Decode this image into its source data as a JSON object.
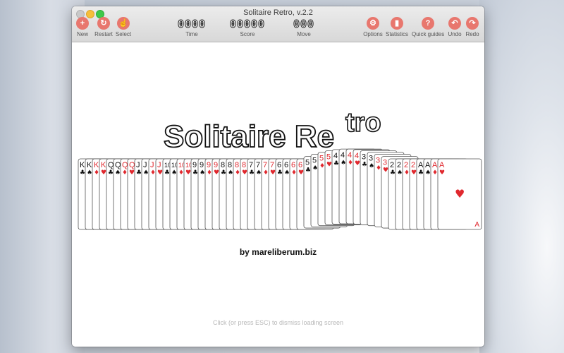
{
  "window": {
    "title": "Solitaire Retro, v.2.2"
  },
  "toolbar": {
    "left": [
      {
        "label": "New",
        "icon": "plus-icon",
        "glyph": "+"
      },
      {
        "label": "Restart",
        "icon": "restart-icon",
        "glyph": "↻"
      },
      {
        "label": "Select",
        "icon": "hand-pointer-icon",
        "glyph": "☝"
      }
    ],
    "right": [
      {
        "label": "Options",
        "icon": "gear-icon",
        "glyph": "⚙"
      },
      {
        "label": "Statistics",
        "icon": "bar-chart-icon",
        "glyph": "▮"
      },
      {
        "label": "Quick guides",
        "icon": "question-icon",
        "glyph": "?"
      },
      {
        "label": "Undo",
        "icon": "undo-arrow-icon",
        "glyph": "↶"
      },
      {
        "label": "Redo",
        "icon": "redo-arrow-icon",
        "glyph": "↷"
      }
    ]
  },
  "counters": {
    "time": {
      "value": "0000",
      "label": "Time"
    },
    "score": {
      "value": "00000",
      "label": "Score"
    },
    "move": {
      "value": "000",
      "label": "Move"
    }
  },
  "splash": {
    "logo_main": "Solitaire Re",
    "logo_super": "tro",
    "byline": "by mareliberum.biz",
    "hint": "Click (or press ESC) to dismiss loading screen"
  },
  "cards": [
    {
      "rank": "K",
      "suit": "♣"
    },
    {
      "rank": "K",
      "suit": "♠"
    },
    {
      "rank": "K",
      "suit": "♦"
    },
    {
      "rank": "K",
      "suit": "♥"
    },
    {
      "rank": "Q",
      "suit": "♣"
    },
    {
      "rank": "Q",
      "suit": "♠"
    },
    {
      "rank": "Q",
      "suit": "♦"
    },
    {
      "rank": "Q",
      "suit": "♥"
    },
    {
      "rank": "J",
      "suit": "♣"
    },
    {
      "rank": "J",
      "suit": "♠"
    },
    {
      "rank": "J",
      "suit": "♦"
    },
    {
      "rank": "J",
      "suit": "♥"
    },
    {
      "rank": "10",
      "suit": "♣"
    },
    {
      "rank": "10",
      "suit": "♠"
    },
    {
      "rank": "10",
      "suit": "♦"
    },
    {
      "rank": "10",
      "suit": "♥"
    },
    {
      "rank": "9",
      "suit": "♣"
    },
    {
      "rank": "9",
      "suit": "♠"
    },
    {
      "rank": "9",
      "suit": "♦"
    },
    {
      "rank": "9",
      "suit": "♥"
    },
    {
      "rank": "8",
      "suit": "♣"
    },
    {
      "rank": "8",
      "suit": "♠"
    },
    {
      "rank": "8",
      "suit": "♦"
    },
    {
      "rank": "8",
      "suit": "♥"
    },
    {
      "rank": "7",
      "suit": "♣"
    },
    {
      "rank": "7",
      "suit": "♠"
    },
    {
      "rank": "7",
      "suit": "♦"
    },
    {
      "rank": "7",
      "suit": "♥"
    },
    {
      "rank": "6",
      "suit": "♣"
    },
    {
      "rank": "6",
      "suit": "♠"
    },
    {
      "rank": "6",
      "suit": "♦"
    },
    {
      "rank": "6",
      "suit": "♥"
    },
    {
      "rank": "5",
      "suit": "♣"
    },
    {
      "rank": "5",
      "suit": "♠"
    },
    {
      "rank": "5",
      "suit": "♦"
    },
    {
      "rank": "5",
      "suit": "♥"
    },
    {
      "rank": "4",
      "suit": "♣"
    },
    {
      "rank": "4",
      "suit": "♠"
    },
    {
      "rank": "4",
      "suit": "♦"
    },
    {
      "rank": "4",
      "suit": "♥"
    },
    {
      "rank": "3",
      "suit": "♣"
    },
    {
      "rank": "3",
      "suit": "♠"
    },
    {
      "rank": "3",
      "suit": "♦"
    },
    {
      "rank": "3",
      "suit": "♥"
    },
    {
      "rank": "2",
      "suit": "♣"
    },
    {
      "rank": "2",
      "suit": "♠"
    },
    {
      "rank": "2",
      "suit": "♦"
    },
    {
      "rank": "2",
      "suit": "♥"
    },
    {
      "rank": "A",
      "suit": "♣"
    },
    {
      "rank": "A",
      "suit": "♠"
    },
    {
      "rank": "A",
      "suit": "♦"
    },
    {
      "rank": "A",
      "suit": "♥"
    }
  ],
  "colors": {
    "red_suit": "#e0282e",
    "black_suit": "#111111",
    "toolbar_icon": "#e8776e"
  }
}
